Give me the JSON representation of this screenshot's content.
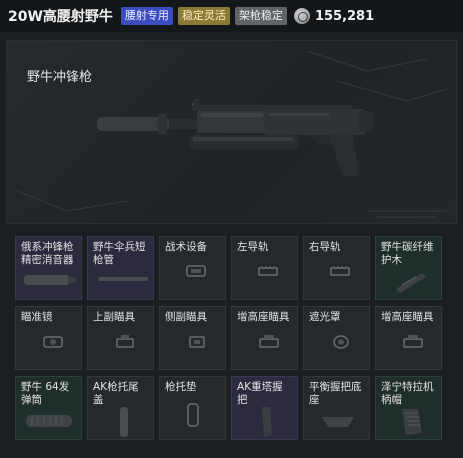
{
  "header": {
    "title": "20W高腰射野牛",
    "tags": [
      {
        "label": "腰射专用",
        "bg": "#3b4cc0",
        "color": "#e8ecff"
      },
      {
        "label": "稳定灵活",
        "bg": "#8a7a35",
        "color": "#fff3c0"
      },
      {
        "label": "架枪稳定",
        "bg": "#5f6468",
        "color": "#eeeeee"
      }
    ],
    "currency_icon": "coin-icon",
    "currency_value": "155,281"
  },
  "weapon": {
    "name": "野牛冲锋枪"
  },
  "slots": [
    {
      "label": "俄系冲锋枪\n精密消音器",
      "tint": "purple",
      "equipped": true
    },
    {
      "label": "野牛伞兵短\n枪管",
      "tint": "purple",
      "equipped": true
    },
    {
      "label": "战术设备",
      "tint": "none",
      "equipped": false
    },
    {
      "label": "左导轨",
      "tint": "none",
      "equipped": false
    },
    {
      "label": "右导轨",
      "tint": "none",
      "equipped": false
    },
    {
      "label": "野牛碳纤维\n护木",
      "tint": "green",
      "equipped": true
    },
    {
      "label": "瞄准镜",
      "tint": "none",
      "equipped": false
    },
    {
      "label": "上副瞄具",
      "tint": "none",
      "equipped": false
    },
    {
      "label": "侧副瞄具",
      "tint": "none",
      "equipped": false
    },
    {
      "label": "增高座瞄具",
      "tint": "none",
      "equipped": false
    },
    {
      "label": "遮光罩",
      "tint": "none",
      "equipped": false
    },
    {
      "label": "增高座瞄具",
      "tint": "none",
      "equipped": false
    },
    {
      "label": "野牛 64发\n弹筒",
      "tint": "green",
      "equipped": true
    },
    {
      "label": "AK枪托尾\n盖",
      "tint": "none",
      "equipped": true
    },
    {
      "label": "枪托垫",
      "tint": "none",
      "equipped": false
    },
    {
      "label": "AK重塔握\n把",
      "tint": "purple",
      "equipped": true
    },
    {
      "label": "平衡握把底\n座",
      "tint": "none",
      "equipped": true
    },
    {
      "label": "泽宁特拉机\n柄帽",
      "tint": "green",
      "equipped": true
    }
  ]
}
